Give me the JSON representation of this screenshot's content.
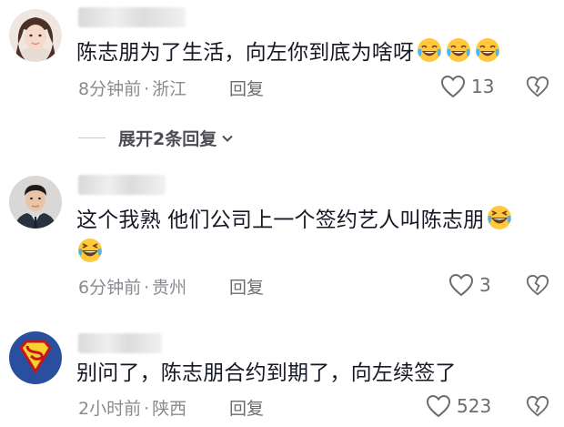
{
  "comments": [
    {
      "text": "陈志朋为了生活，向左你到底为啥呀",
      "emoji_count": 3,
      "emoji": "crying-laughing-face-icon",
      "time": "8分钟前",
      "location": "浙江",
      "reply_label": "回复",
      "likes": "13",
      "avatar": "woman-portrait"
    },
    {
      "text": "这个我熟 他们公司上一个签约艺人叫陈志朋",
      "emoji_count": 2,
      "emoji": "laughing-face-icon",
      "time": "6分钟前",
      "location": "贵州",
      "reply_label": "回复",
      "likes": "3",
      "avatar": "man-in-suit-portrait"
    },
    {
      "text": "别问了，陈志朋合约到期了，向左续签了",
      "emoji_count": 0,
      "time": "2小时前",
      "location": "陕西",
      "reply_label": "回复",
      "likes": "523",
      "avatar": "superman-logo"
    }
  ],
  "expand_replies": {
    "label": "展开2条回复"
  },
  "separator": "·",
  "colors": {
    "text": "#161823",
    "meta": "#8a8b91",
    "emoji_face": "#ffc83d"
  }
}
